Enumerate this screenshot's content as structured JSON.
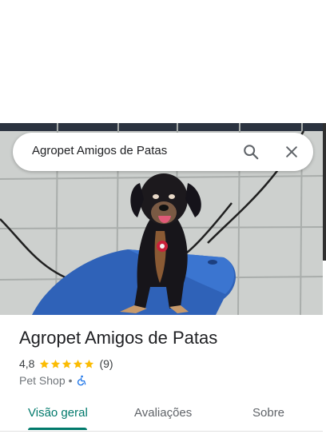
{
  "colors": {
    "accent": "#00796b",
    "star": "#fbbc04",
    "accessibility": "#1a73e8",
    "text_primary": "#202124",
    "text_secondary": "#70757a"
  },
  "search": {
    "query": "Agropet Amigos de Patas",
    "search_icon": "search-icon",
    "close_icon": "close-icon"
  },
  "photo": {
    "subject": "dog-photo"
  },
  "place": {
    "name": "Agropet Amigos de Patas",
    "rating": "4,8",
    "rating_value": 4.8,
    "stars": 5,
    "review_count": "(9)",
    "category": "Pet Shop",
    "separator": "•",
    "accessibility_icon": "wheelchair-icon"
  },
  "tabs": [
    {
      "label": "Visão geral",
      "active": true
    },
    {
      "label": "Avaliações",
      "active": false
    },
    {
      "label": "Sobre",
      "active": false
    }
  ]
}
